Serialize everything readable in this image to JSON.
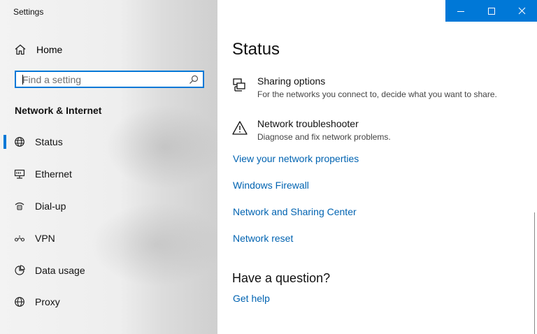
{
  "window": {
    "title": "Settings"
  },
  "sidebar": {
    "home_label": "Home",
    "search_placeholder": "Find a setting",
    "section_title": "Network & Internet",
    "items": [
      {
        "label": "Status",
        "icon": "globe-icon",
        "active": true
      },
      {
        "label": "Ethernet",
        "icon": "ethernet-icon",
        "active": false
      },
      {
        "label": "Dial-up",
        "icon": "dialup-icon",
        "active": false
      },
      {
        "label": "VPN",
        "icon": "vpn-icon",
        "active": false
      },
      {
        "label": "Data usage",
        "icon": "data-usage-icon",
        "active": false
      },
      {
        "label": "Proxy",
        "icon": "proxy-icon",
        "active": false
      }
    ]
  },
  "main": {
    "title": "Status",
    "options": [
      {
        "title": "Sharing options",
        "desc": "For the networks you connect to, decide what you want to share.",
        "icon": "sharing-icon"
      },
      {
        "title": "Network troubleshooter",
        "desc": "Diagnose and fix network problems.",
        "icon": "warning-icon"
      }
    ],
    "links": [
      "View your network properties",
      "Windows Firewall",
      "Network and Sharing Center",
      "Network reset"
    ],
    "question_heading": "Have a question?",
    "help_link": "Get help"
  },
  "colors": {
    "accent": "#0078d7",
    "link": "#0063b1"
  }
}
